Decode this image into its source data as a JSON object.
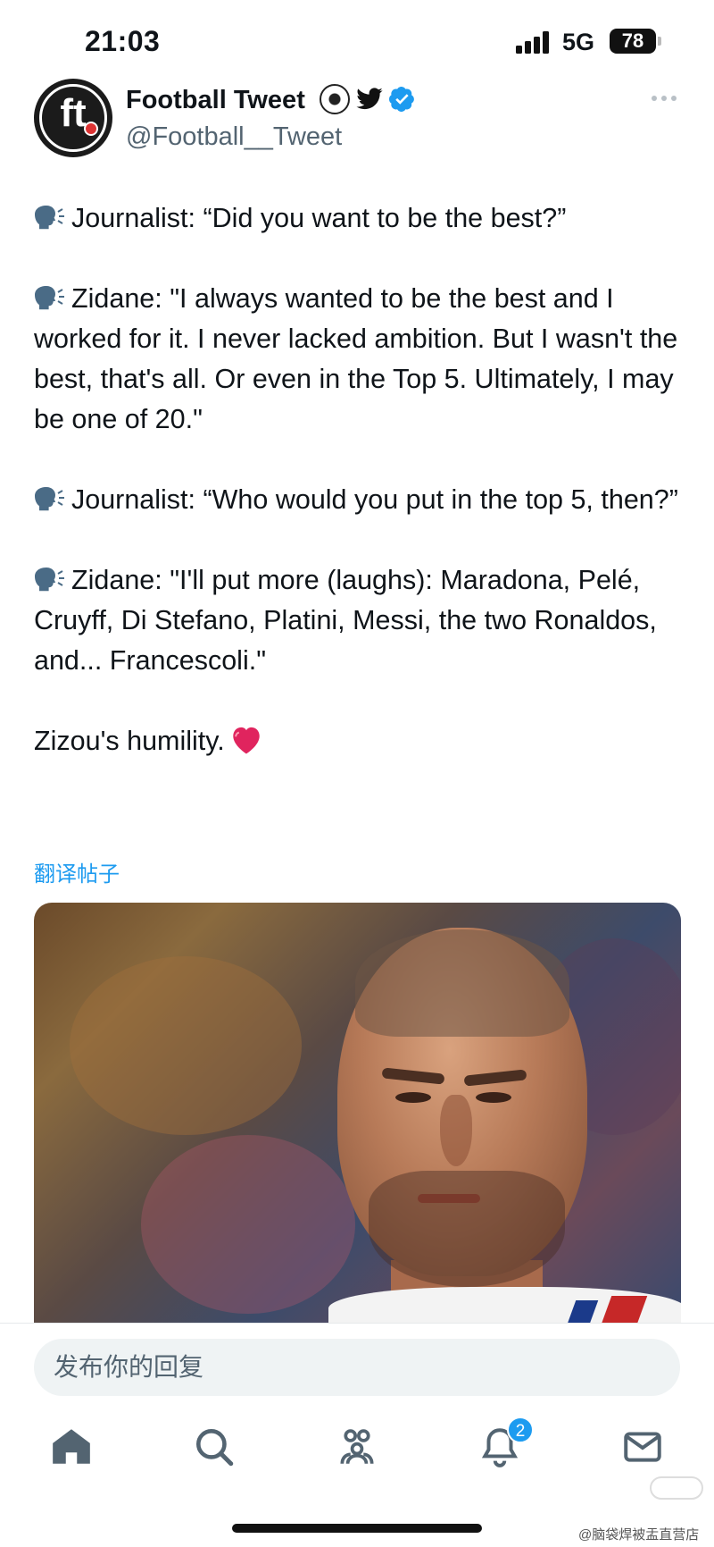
{
  "status_bar": {
    "time": "21:03",
    "network": "5G",
    "battery": "78"
  },
  "tweet": {
    "author": {
      "display_name": "Football Tweet",
      "handle": "@Football__Tweet",
      "avatar_text": "ft"
    },
    "paragraphs": [
      "Journalist: “Did you want to be the best?”",
      "Zidane: \"I always wanted to be the best and I worked for it. I never lacked ambition. But I wasn't the best, that's all. Or even in the Top 5. Ultimately, I may be one of 20.\"",
      "Journalist: “Who would you put in the top 5, then?”",
      "Zidane: \"I'll put more (laughs): Maradona, Pelé, Cruyff, Di Stefano, Platini, Messi, the two Ronaldos, and... Francescoli.\""
    ],
    "closing": "Zizou's humility.",
    "translate_label": "翻译帖子"
  },
  "reply": {
    "placeholder": "发布你的回复"
  },
  "tab_bar": {
    "items": [
      "home-icon",
      "search-icon",
      "communities-icon",
      "notifications-icon",
      "messages-icon"
    ],
    "notification_count": "2"
  },
  "watermark": "@脑袋焊被盂直营店",
  "colors": {
    "accent": "#1d9bf0",
    "text": "#0f1419",
    "secondary": "#536471",
    "heart": "#e0245e"
  }
}
